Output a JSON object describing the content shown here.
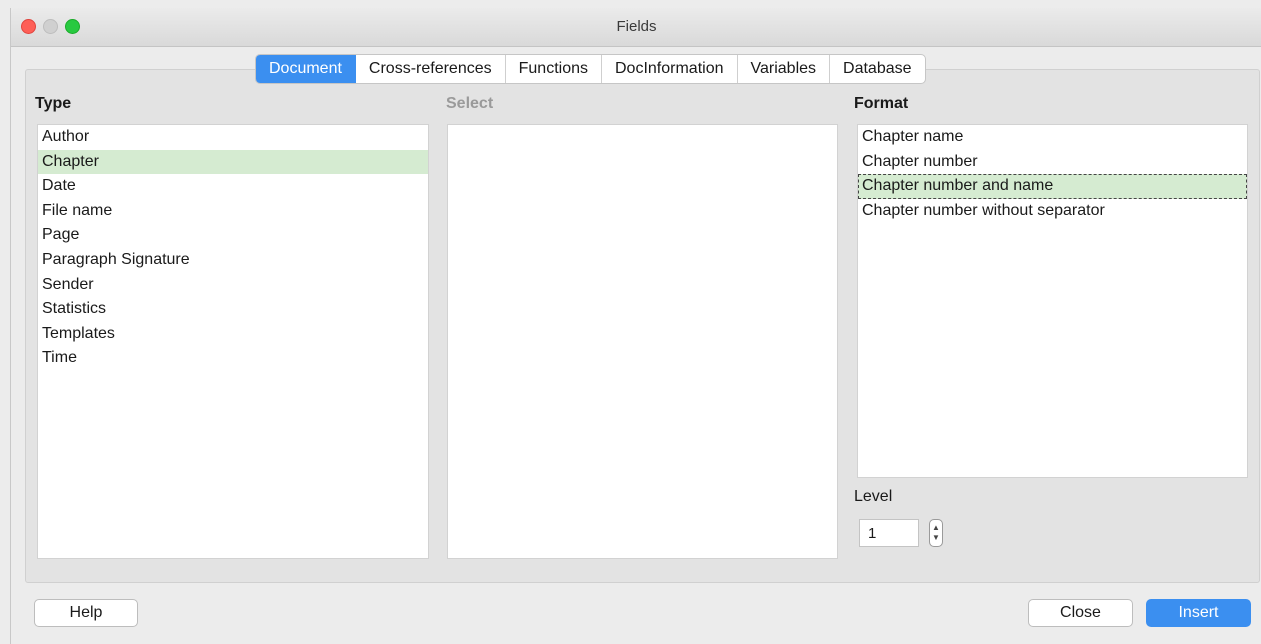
{
  "window": {
    "title": "Fields"
  },
  "tabs": [
    {
      "label": "Document",
      "active": true
    },
    {
      "label": "Cross-references",
      "active": false
    },
    {
      "label": "Functions",
      "active": false
    },
    {
      "label": "DocInformation",
      "active": false
    },
    {
      "label": "Variables",
      "active": false
    },
    {
      "label": "Database",
      "active": false
    }
  ],
  "type": {
    "label": "Type",
    "items": [
      "Author",
      "Chapter",
      "Date",
      "File name",
      "Page",
      "Paragraph Signature",
      "Sender",
      "Statistics",
      "Templates",
      "Time"
    ],
    "selected": "Chapter"
  },
  "select": {
    "label": "Select"
  },
  "format": {
    "label": "Format",
    "items": [
      "Chapter name",
      "Chapter number",
      "Chapter number and name",
      "Chapter number without separator"
    ],
    "selected": "Chapter number and name"
  },
  "level": {
    "label": "Level",
    "value": "1"
  },
  "buttons": {
    "help": "Help",
    "close": "Close",
    "insert": "Insert"
  },
  "colors": {
    "accent": "#3b8ff0",
    "selection": "#d5ebd1"
  }
}
